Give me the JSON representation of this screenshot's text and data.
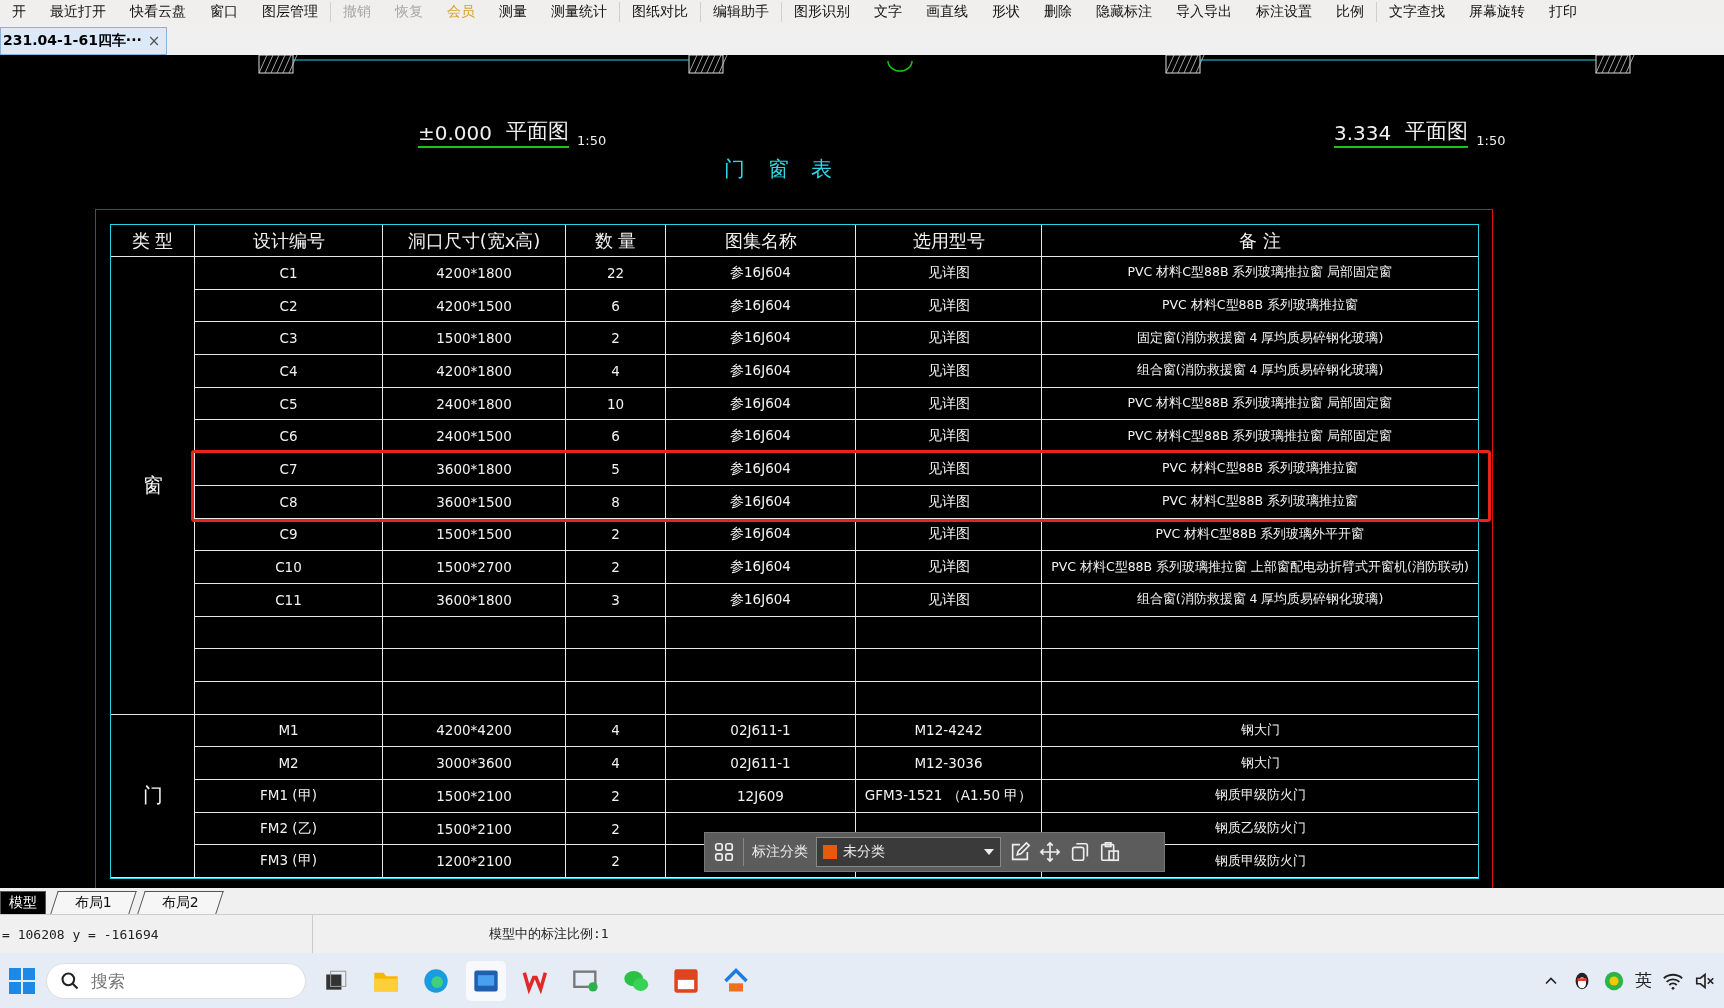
{
  "menu": [
    {
      "label": "开",
      "kind": "action",
      "disabled": false,
      "separator_after": false
    },
    {
      "label": "最近打开",
      "kind": "action",
      "disabled": false,
      "separator_after": false
    },
    {
      "label": "快看云盘",
      "kind": "action",
      "disabled": false,
      "separator_after": false
    },
    {
      "label": "窗口",
      "kind": "action",
      "disabled": false,
      "separator_after": false
    },
    {
      "label": "图层管理",
      "kind": "action",
      "disabled": false,
      "separator_after": true
    },
    {
      "label": "撤销",
      "kind": "action",
      "disabled": true,
      "separator_after": false
    },
    {
      "label": "恢复",
      "kind": "action",
      "disabled": true,
      "separator_after": false
    },
    {
      "label": "会员",
      "kind": "member",
      "disabled": false,
      "separator_after": false
    },
    {
      "label": "测量",
      "kind": "action",
      "disabled": false,
      "separator_after": false
    },
    {
      "label": "测量统计",
      "kind": "action",
      "disabled": false,
      "separator_after": true
    },
    {
      "label": "图纸对比",
      "kind": "action",
      "disabled": false,
      "separator_after": true
    },
    {
      "label": "编辑助手",
      "kind": "action",
      "disabled": false,
      "separator_after": true
    },
    {
      "label": "图形识别",
      "kind": "action",
      "disabled": false,
      "separator_after": false
    },
    {
      "label": "文字",
      "kind": "action",
      "disabled": false,
      "separator_after": false
    },
    {
      "label": "画直线",
      "kind": "action",
      "disabled": false,
      "separator_after": false
    },
    {
      "label": "形状",
      "kind": "action",
      "disabled": false,
      "separator_after": false
    },
    {
      "label": "删除",
      "kind": "action",
      "disabled": false,
      "separator_after": false
    },
    {
      "label": "隐藏标注",
      "kind": "action",
      "disabled": false,
      "separator_after": false
    },
    {
      "label": "导入导出",
      "kind": "action",
      "disabled": false,
      "separator_after": false
    },
    {
      "label": "标注设置",
      "kind": "action",
      "disabled": false,
      "separator_after": false
    },
    {
      "label": "比例",
      "kind": "action",
      "disabled": false,
      "separator_after": true
    },
    {
      "label": "文字查找",
      "kind": "action",
      "disabled": false,
      "separator_after": false
    },
    {
      "label": "屏幕旋转",
      "kind": "action",
      "disabled": false,
      "separator_after": false
    },
    {
      "label": "打印",
      "kind": "action",
      "disabled": false,
      "separator_after": false
    }
  ],
  "doc_tabs": [
    {
      "label": "231.04-1-61四车···",
      "close": "×",
      "selected": true
    }
  ],
  "drawing": {
    "plan_labels": [
      {
        "elevation": "±0.000",
        "name": "平面图",
        "scale": "1:50"
      },
      {
        "elevation": "3.334",
        "name": "平面图",
        "scale": "1:50"
      }
    ],
    "table_title": "门 窗 表",
    "table": {
      "columns": [
        "类 型",
        "设计编号",
        "洞口尺寸(宽x高)",
        "数 量",
        "图集名称",
        "选用型号",
        "备  注"
      ],
      "groups": [
        {
          "type": "窗",
          "rows": [
            {
              "kind": "item",
              "code": "C1",
              "size": "4200*1800",
              "qty": "22",
              "atlas": "参16J604",
              "model": "见详图",
              "remark": "PVC 材料C型88B 系列玻璃推拉窗 局部固定窗",
              "highlighted": false
            },
            {
              "kind": "item",
              "code": "C2",
              "size": "4200*1500",
              "qty": "6",
              "atlas": "参16J604",
              "model": "见详图",
              "remark": "PVC 材料C型88B 系列玻璃推拉窗",
              "highlighted": false
            },
            {
              "kind": "item",
              "code": "C3",
              "size": "1500*1800",
              "qty": "2",
              "atlas": "参16J604",
              "model": "见详图",
              "remark": "固定窗(消防救援窗 4 厚均质易碎钢化玻璃)",
              "highlighted": false
            },
            {
              "kind": "item",
              "code": "C4",
              "size": "4200*1800",
              "qty": "4",
              "atlas": "参16J604",
              "model": "见详图",
              "remark": "组合窗(消防救援窗 4 厚均质易碎钢化玻璃)",
              "highlighted": false
            },
            {
              "kind": "item",
              "code": "C5",
              "size": "2400*1800",
              "qty": "10",
              "atlas": "参16J604",
              "model": "见详图",
              "remark": "PVC 材料C型88B 系列玻璃推拉窗 局部固定窗",
              "highlighted": false
            },
            {
              "kind": "item",
              "code": "C6",
              "size": "2400*1500",
              "qty": "6",
              "atlas": "参16J604",
              "model": "见详图",
              "remark": "PVC 材料C型88B 系列玻璃推拉窗 局部固定窗",
              "highlighted": false
            },
            {
              "kind": "item",
              "code": "C7",
              "size": "3600*1800",
              "qty": "5",
              "atlas": "参16J604",
              "model": "见详图",
              "remark": "PVC 材料C型88B 系列玻璃推拉窗",
              "highlighted": true
            },
            {
              "kind": "item",
              "code": "C8",
              "size": "3600*1500",
              "qty": "8",
              "atlas": "参16J604",
              "model": "见详图",
              "remark": "PVC 材料C型88B 系列玻璃推拉窗",
              "highlighted": true
            },
            {
              "kind": "item",
              "code": "C9",
              "size": "1500*1500",
              "qty": "2",
              "atlas": "参16J604",
              "model": "见详图",
              "remark": "PVC 材料C型88B 系列玻璃外平开窗",
              "highlighted": false
            },
            {
              "kind": "item",
              "code": "C10",
              "size": "1500*2700",
              "qty": "2",
              "atlas": "参16J604",
              "model": "见详图",
              "remark": "PVC 材料C型88B 系列玻璃推拉窗 上部窗配电动折臂式开窗机(消防联动)",
              "highlighted": false
            },
            {
              "kind": "item",
              "code": "C11",
              "size": "3600*1800",
              "qty": "3",
              "atlas": "参16J604",
              "model": "见详图",
              "remark": "组合窗(消防救援窗 4 厚均质易碎钢化玻璃)",
              "highlighted": false
            },
            {
              "kind": "blank"
            },
            {
              "kind": "blank"
            },
            {
              "kind": "blank"
            }
          ]
        },
        {
          "type": "门",
          "rows": [
            {
              "kind": "item",
              "code": "M1",
              "size": "4200*4200",
              "qty": "4",
              "atlas": "02J611-1",
              "model": "M12-4242",
              "remark": "钢大门",
              "highlighted": false
            },
            {
              "kind": "item",
              "code": "M2",
              "size": "3000*3600",
              "qty": "4",
              "atlas": "02J611-1",
              "model": "M12-3036",
              "remark": "钢大门",
              "highlighted": false
            },
            {
              "kind": "item",
              "code": "FM1 (甲)",
              "size": "1500*2100",
              "qty": "2",
              "atlas": "12J609",
              "model": "GFM3-1521 （A1.50 甲）",
              "remark": "钢质甲级防火门",
              "highlighted": false
            },
            {
              "kind": "item",
              "code": "FM2 (乙)",
              "size": "1500*2100",
              "qty": "2",
              "remark": "钢质乙级防火门",
              "highlighted": false
            },
            {
              "kind": "item",
              "code": "FM3 (甲)",
              "size": "1200*2100",
              "qty": "2",
              "remark": "钢质甲级防火门",
              "highlighted": false
            }
          ]
        }
      ]
    }
  },
  "float_toolbar": {
    "label": "标注分类",
    "category": {
      "value": "未分类",
      "color": "#e8590c"
    }
  },
  "layout_tabs": [
    {
      "label": "模型",
      "selected": true
    },
    {
      "label": "布局1",
      "selected": false
    },
    {
      "label": "布局2",
      "selected": false
    }
  ],
  "status_bar": {
    "coords": "= 106208 y = -161694",
    "scale": "模型中的标注比例:1"
  },
  "taskbar": {
    "search_placeholder": "搜索",
    "ime": "英"
  }
}
